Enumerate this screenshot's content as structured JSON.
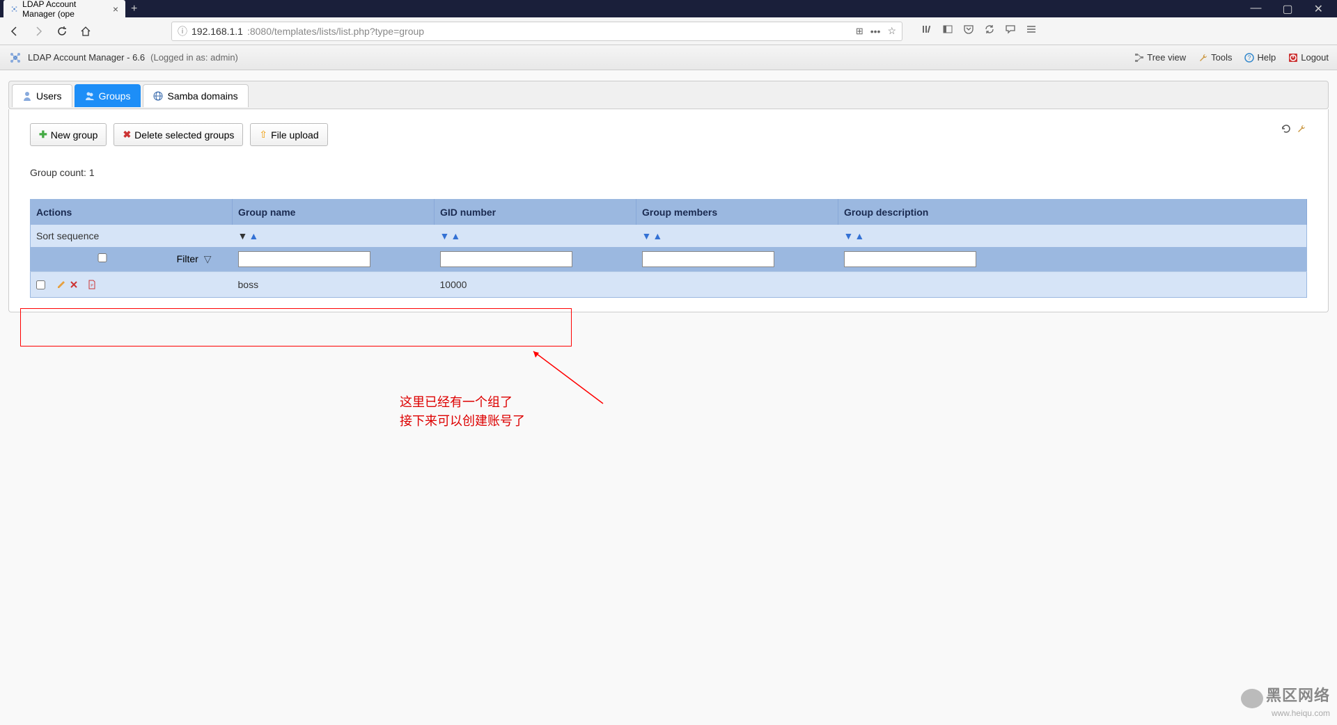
{
  "browser": {
    "tab_title": "LDAP Account Manager (ope",
    "url_host": "192.168.1.1",
    "url_path": ":8080/templates/lists/list.php?type=group"
  },
  "header": {
    "app_title": "LDAP Account Manager - 6.6",
    "login_info": "(Logged in as: admin)",
    "links": {
      "tree_view": "Tree view",
      "tools": "Tools",
      "help": "Help",
      "logout": "Logout"
    }
  },
  "tabs": {
    "users": "Users",
    "groups": "Groups",
    "samba": "Samba domains"
  },
  "buttons": {
    "new_group": "New group",
    "delete_selected": "Delete selected groups",
    "file_upload": "File upload"
  },
  "count_label": "Group count: 1",
  "table": {
    "headers": {
      "actions": "Actions",
      "group_name": "Group name",
      "gid_number": "GID number",
      "members": "Group members",
      "description": "Group description"
    },
    "sort_label": "Sort sequence",
    "filter_label": "Filter",
    "rows": [
      {
        "group_name": "boss",
        "gid_number": "10000",
        "members": "",
        "description": ""
      }
    ]
  },
  "annotation": {
    "line1": "这里已经有一个组了",
    "line2": "接下来可以创建账号了"
  },
  "watermark": {
    "title": "黑区网络",
    "url": "www.heiqu.com"
  }
}
